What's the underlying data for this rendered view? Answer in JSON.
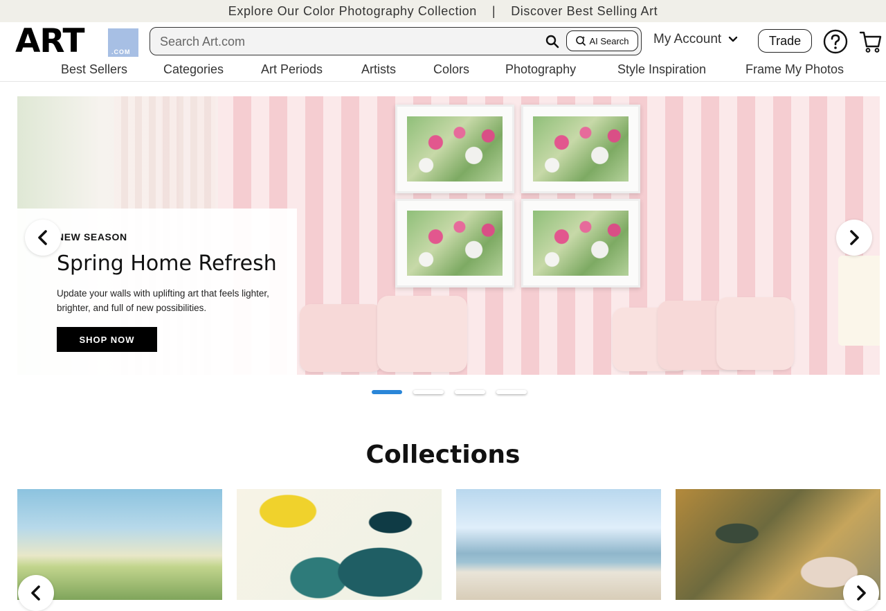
{
  "promo": {
    "left": "Explore Our Color Photography Collection",
    "separator": "|",
    "right": "Discover Best Selling Art"
  },
  "header": {
    "logo_main": "ART",
    "logo_suffix": ".COM",
    "search_placeholder": "Search Art.com",
    "ai_search_label": "AI Search",
    "account_label": "My Account",
    "trade_label": "Trade"
  },
  "nav": {
    "items": [
      "Best Sellers",
      "Categories",
      "Art Periods",
      "Artists",
      "Colors",
      "Photography",
      "Style Inspiration",
      "Frame My Photos"
    ]
  },
  "hero": {
    "eyebrow": "NEW SEASON",
    "title": "Spring Home Refresh",
    "description": "Update your walls with uplifting art that feels lighter, brighter, and full of new possibilities.",
    "cta": "SHOP NOW",
    "slide_count": 4,
    "active_slide": 1
  },
  "collections": {
    "title": "Collections"
  },
  "colors": {
    "accent": "#2a86d8",
    "logo_box": "#a7bfe4",
    "promo_bg": "#f0efe9",
    "cta_bg": "#000000"
  },
  "icons": [
    "search-icon",
    "ai-search-icon",
    "chevron-down-icon",
    "help-icon",
    "cart-icon",
    "chevron-left-icon",
    "chevron-right-icon"
  ]
}
